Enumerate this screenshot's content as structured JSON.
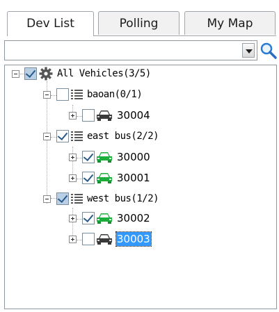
{
  "tabs": [
    {
      "label": "Dev List",
      "active": true
    },
    {
      "label": "Polling",
      "active": false
    },
    {
      "label": "My Map",
      "active": false
    }
  ],
  "search": {
    "value": "",
    "placeholder": ""
  },
  "tree": {
    "root": {
      "label": "All Vehicles(3/5)",
      "expanded": true,
      "check": "partial"
    },
    "groups": [
      {
        "label": "baoan(0/1)",
        "expanded": true,
        "check": "unchecked",
        "vehicles": [
          {
            "label": "30004",
            "checked": false,
            "status": "offline",
            "selected": false
          }
        ]
      },
      {
        "label": "east bus(2/2)",
        "expanded": true,
        "check": "checked",
        "vehicles": [
          {
            "label": "30000",
            "checked": true,
            "status": "online",
            "selected": false
          },
          {
            "label": "30001",
            "checked": true,
            "status": "online",
            "selected": false
          }
        ]
      },
      {
        "label": "west bus(1/2)",
        "expanded": true,
        "check": "partial",
        "vehicles": [
          {
            "label": "30002",
            "checked": true,
            "status": "online",
            "selected": false
          },
          {
            "label": "30003",
            "checked": false,
            "status": "offline",
            "selected": true
          }
        ]
      }
    ]
  },
  "colors": {
    "online": "#1cae3c",
    "offline": "#3a3a3a",
    "selection": "#3399ff",
    "check": "#2a5a8a"
  },
  "icons": {
    "root": "gear-icon",
    "group": "list-icon",
    "vehicle": "car-icon",
    "search": "magnifier-icon"
  }
}
